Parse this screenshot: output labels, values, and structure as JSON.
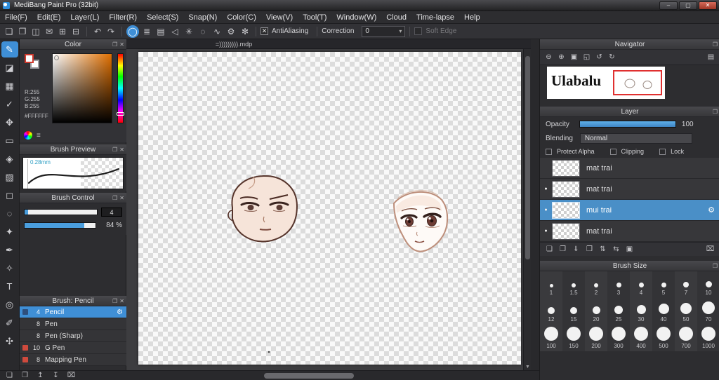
{
  "window": {
    "title": "MediBang Paint Pro (32bit)",
    "controls": [
      {
        "name": "minimize-button",
        "glyph": "–"
      },
      {
        "name": "maximize-button",
        "glyph": "▢"
      },
      {
        "name": "close-button",
        "glyph": "✕"
      }
    ]
  },
  "menu": {
    "items": [
      "File(F)",
      "Edit(E)",
      "Layer(L)",
      "Filter(R)",
      "Select(S)",
      "Snap(N)",
      "Color(C)",
      "View(V)",
      "Tool(T)",
      "Window(W)",
      "Cloud",
      "Time-lapse",
      "Help"
    ]
  },
  "icons": {
    "gear_glyph": "⚙",
    "visible_glyph": "●",
    "dropdown_arrow_glyph": "▾",
    "popout_glyph": "❐",
    "close_glyph": "✕",
    "scroll_down_glyph": "▼",
    "checked_glyph": "✕"
  },
  "toolbar": {
    "file_icons": [
      {
        "name": "new-file-icon",
        "glyph": "❏"
      },
      {
        "name": "open-file-icon",
        "glyph": "❐"
      },
      {
        "name": "save-icon",
        "glyph": "◫"
      },
      {
        "name": "comment-icon",
        "glyph": "✉"
      },
      {
        "name": "grid-view-icon",
        "glyph": "⊞"
      },
      {
        "name": "panel-layout-icon",
        "glyph": "⊟"
      }
    ],
    "undo_icons": [
      {
        "name": "undo-icon",
        "glyph": "↶"
      },
      {
        "name": "redo-icon",
        "glyph": "↷"
      }
    ],
    "snap_icons": [
      {
        "name": "snap-off-icon",
        "glyph": "◯",
        "selected": true
      },
      {
        "name": "snap-parallel-icon",
        "glyph": "≣"
      },
      {
        "name": "snap-crisscross-icon",
        "glyph": "▤"
      },
      {
        "name": "snap-vanishing-point-icon",
        "glyph": "◁"
      },
      {
        "name": "snap-radial-icon",
        "glyph": "✳"
      },
      {
        "name": "snap-ellipse-icon",
        "glyph": "◌"
      },
      {
        "name": "snap-curve-icon",
        "glyph": "∿"
      },
      {
        "name": "snap-settings-icon",
        "glyph": "⚙"
      },
      {
        "name": "snap-config-icon",
        "glyph": "✻"
      }
    ],
    "antialiasing_label": "AntiAliasing",
    "correction_label": "Correction",
    "correction_value": "0",
    "soft_edge_label": "Soft Edge"
  },
  "tools": [
    {
      "name": "brush-tool",
      "glyph": "✎",
      "selected": true
    },
    {
      "name": "eraser-tool",
      "glyph": "◪"
    },
    {
      "name": "blur-tool",
      "glyph": "▦"
    },
    {
      "name": "dot-pen-tool",
      "glyph": "✓"
    },
    {
      "name": "move-tool",
      "glyph": "✥"
    },
    {
      "name": "transform-tool",
      "glyph": "▭"
    },
    {
      "name": "bucket-tool",
      "glyph": "◈"
    },
    {
      "name": "gradient-tool",
      "glyph": "▨"
    },
    {
      "name": "select-tool",
      "glyph": "◻"
    },
    {
      "name": "lasso-tool",
      "glyph": "◌"
    },
    {
      "name": "operation-tool",
      "glyph": "✦"
    },
    {
      "name": "pen-tool",
      "glyph": "✒"
    },
    {
      "name": "eyedropper-tool",
      "glyph": "✧"
    },
    {
      "name": "text-tool",
      "glyph": "T"
    },
    {
      "name": "zoom-tool",
      "glyph": "◎"
    },
    {
      "name": "divide-tool",
      "glyph": "✐"
    },
    {
      "name": "hand-tool",
      "glyph": "✣"
    }
  ],
  "color_panel": {
    "title": "Color",
    "r_label": "R:255",
    "g_label": "G:255",
    "b_label": "B:255",
    "hex_label": "#FFFFFF",
    "foreground_color": "#ffffff",
    "hue_color": "#e06f00"
  },
  "brush_preview": {
    "title": "Brush Preview",
    "size_label": "0.28mm"
  },
  "brush_control": {
    "title": "Brush Control",
    "size_value": "4",
    "opacity_percent": 84,
    "opacity_label": "84 %"
  },
  "brush_panel": {
    "title": "Brush: Pencil",
    "brushes": [
      {
        "size": "4",
        "name": "Pencil",
        "tag": "#2e4f7d",
        "selected": true
      },
      {
        "size": "8",
        "name": "Pen",
        "tag": null,
        "selected": false
      },
      {
        "size": "8",
        "name": "Pen (Sharp)",
        "tag": null,
        "selected": false
      },
      {
        "size": "10",
        "name": "G Pen",
        "tag": "#cf4a3d",
        "selected": false
      },
      {
        "size": "8",
        "name": "Mapping Pen",
        "tag": "#cf4a3d",
        "selected": false
      }
    ],
    "footer_icons": [
      {
        "name": "add-brush-icon",
        "glyph": "❏"
      },
      {
        "name": "duplicate-brush-icon",
        "glyph": "❐"
      },
      {
        "name": "brush-up-icon",
        "glyph": "↥"
      },
      {
        "name": "brush-down-icon",
        "glyph": "↧"
      },
      {
        "name": "delete-brush-icon",
        "glyph": "⌧"
      }
    ]
  },
  "canvas": {
    "tab_title": "=))))))))).mdp"
  },
  "navigator": {
    "title": "Navigator",
    "zoom_icons": [
      {
        "name": "zoom-out-icon",
        "glyph": "⊖"
      },
      {
        "name": "zoom-in-icon",
        "glyph": "⊕"
      },
      {
        "name": "fit-window-icon",
        "glyph": "▣"
      },
      {
        "name": "actual-size-icon",
        "glyph": "◱"
      },
      {
        "name": "rotate-left-icon",
        "glyph": "↺"
      },
      {
        "name": "rotate-right-icon",
        "glyph": "↻"
      },
      {
        "name": "reset-view-icon",
        "glyph": "▤"
      }
    ],
    "preview_text": "Ulabalu"
  },
  "layer_panel": {
    "title": "Layer",
    "opacity_label": "Opacity",
    "opacity_value": "100",
    "blending_label": "Blending",
    "blending_value": "Normal",
    "protect_alpha_label": "Protect Alpha",
    "clipping_label": "Clipping",
    "lock_label": "Lock",
    "layers": [
      {
        "name": "mat trai",
        "visible": false,
        "selected": false
      },
      {
        "name": "mat trai",
        "visible": true,
        "selected": false
      },
      {
        "name": "mui trai",
        "visible": true,
        "selected": true
      },
      {
        "name": "mat trai",
        "visible": true,
        "selected": false
      }
    ],
    "toolbar_icons": [
      {
        "name": "new-layer-icon",
        "glyph": "❏"
      },
      {
        "name": "duplicate-layer-icon",
        "glyph": "❐"
      },
      {
        "name": "merge-down-icon",
        "glyph": "⇓"
      },
      {
        "name": "layer-folder-icon",
        "glyph": "❒"
      },
      {
        "name": "move-layer-icon",
        "glyph": "⇅"
      },
      {
        "name": "transfer-layer-icon",
        "glyph": "⇆"
      },
      {
        "name": "copy-layer-icon",
        "glyph": "▣"
      },
      {
        "name": "delete-layer-icon",
        "glyph": "⌧"
      }
    ]
  },
  "brush_size_panel": {
    "title": "Brush Size",
    "sizes": [
      1,
      1.5,
      2,
      3,
      4,
      5,
      7,
      10,
      12,
      15,
      20,
      25,
      30,
      40,
      50,
      70,
      100,
      150,
      200,
      300,
      400,
      500,
      700,
      1000
    ]
  }
}
